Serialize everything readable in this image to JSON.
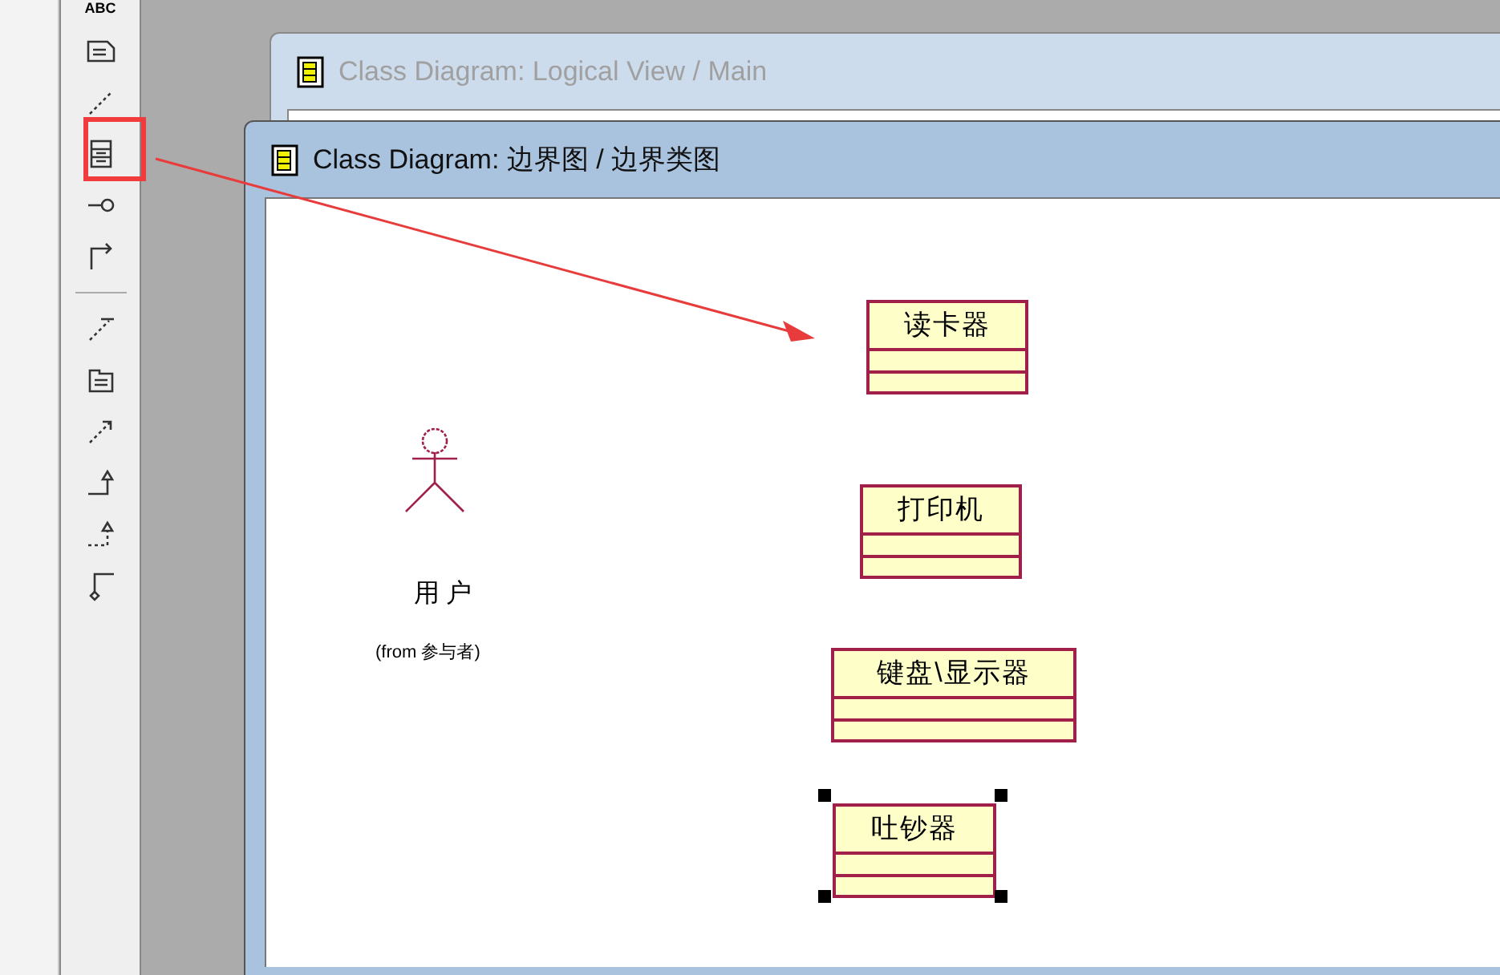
{
  "toolbar": {
    "text_tool_label": "ABC"
  },
  "windows": [
    {
      "title": "Class Diagram: Logical View / Main",
      "active": false
    },
    {
      "title": "Class Diagram: 边界图 / 边界类图",
      "active": true
    }
  ],
  "actor": {
    "name": "用户",
    "source": "(from 参与者)"
  },
  "classes": [
    {
      "name": "读卡器",
      "selected": false
    },
    {
      "name": "打印机",
      "selected": false
    },
    {
      "name": "键盘\\显示器",
      "selected": false
    },
    {
      "name": "吐钞器",
      "selected": true
    }
  ]
}
